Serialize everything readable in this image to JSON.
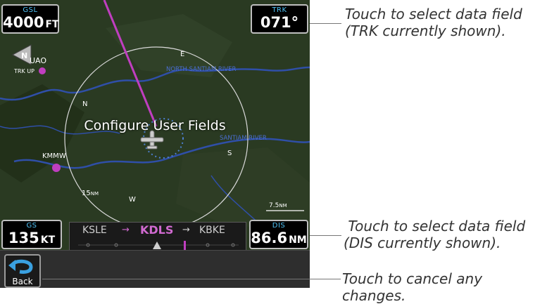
{
  "fields": {
    "top_left": {
      "label": "GSL",
      "value": "4000",
      "unit": "FT"
    },
    "top_right": {
      "label": "TRK",
      "value": "071°",
      "unit": ""
    },
    "bottom_left": {
      "label": "GS",
      "value": "135",
      "unit": "KT"
    },
    "bottom_right": {
      "label": "DIS",
      "value": "86.6",
      "unit": "NM"
    }
  },
  "overlay_title": "Configure User Fields",
  "route": {
    "from": "KSLE",
    "active": "KDLS",
    "to": "KBKE",
    "arrow": "→"
  },
  "map": {
    "north_indicator": "N",
    "orientation": "TRK UP",
    "airport_top": "UAO",
    "airport_left": "KMMW",
    "river_1": "NORTH SANTIAM RIVER",
    "river_2": "SANTIAM RIVER",
    "compass_n": "N",
    "compass_e": "E",
    "compass_s": "S",
    "compass_w": "W",
    "range_ring": "15",
    "range_ring_unit": "NM",
    "scale": "7.5",
    "scale_unit": "NM"
  },
  "back_button": {
    "label": "Back"
  },
  "callouts": {
    "trk": [
      "Touch to select data field",
      "(TRK currently shown)."
    ],
    "dis": [
      " Touch to select data field",
      "(DIS currently shown)."
    ],
    "back": "Touch to cancel any changes."
  },
  "colors": {
    "route_magenta": "#c03ec0",
    "field_label": "#4fc3f7",
    "river": "#2f4fa8"
  }
}
